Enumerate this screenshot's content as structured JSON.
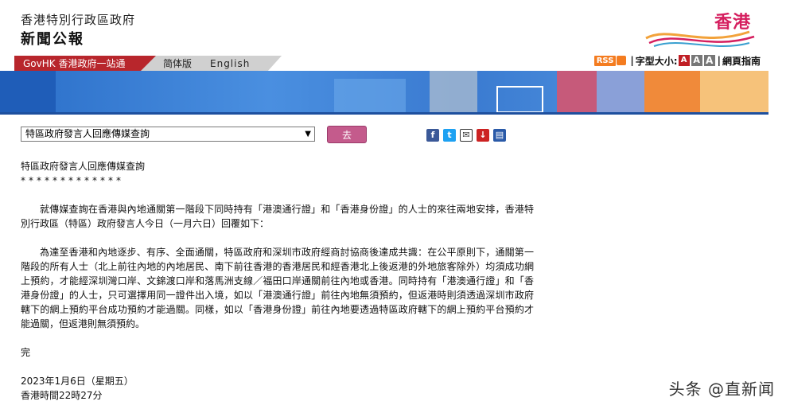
{
  "header": {
    "gov_title": "香港特別行政區政府",
    "press_title": "新聞公報",
    "logo_text": "香港"
  },
  "nav": {
    "govhk": "GovHK 香港政府一站通",
    "simplified": "简体版",
    "english": "English"
  },
  "tools": {
    "rss": "RSS",
    "font_size_label": "字型大小:",
    "font_buttons": [
      "A",
      "A",
      "A"
    ],
    "page_guide": "網頁指南"
  },
  "toolbar": {
    "select_value": "特區政府發言人回應傳媒查詢",
    "go_label": "去"
  },
  "share_icons": [
    "facebook-icon",
    "twitter-icon",
    "email-icon",
    "bookmark-icon",
    "print-icon"
  ],
  "article": {
    "title": "特區政府發言人回應傳媒查詢",
    "stars": "*************",
    "para1": "就傳媒查詢在香港與內地通關第一階段下同時持有「港澳通行證」和「香港身份證」的人士的來往兩地安排，香港特別行政區（特區）政府發言人今日（一月六日）回覆如下：",
    "para2": "為達至香港和內地逐步、有序、全面通關，特區政府和深圳市政府經商討協商後達成共識：在公平原則下，通關第一階段的所有人士（北上前往內地的內地居民、南下前往香港的香港居民和經香港北上後返港的外地旅客除外）均須成功網上預約，才能經深圳灣口岸、文錦渡口岸和落馬洲支線／福田口岸通關前往內地或香港。同時持有「港澳通行證」和「香港身份證」的人士，只可選擇用同一證件出入境，如以「港澳通行證」前往內地無須預約，但返港時則須透過深圳市政府轄下的網上預約平台成功預約才能過關。同樣，如以「香港身份證」前往內地要透過特區政府轄下的網上預約平台預約才能過關，但返港則無須預約。",
    "end": "完",
    "date": "2023年1月6日（星期五）",
    "time": "香港時間22時27分"
  },
  "watermark": "头条 @直新闻",
  "colors": {
    "nav_red": "#b8262c",
    "go_button": "#c45b8c",
    "rss": "#f47c20",
    "banner_blue": "#1d4f9e"
  }
}
